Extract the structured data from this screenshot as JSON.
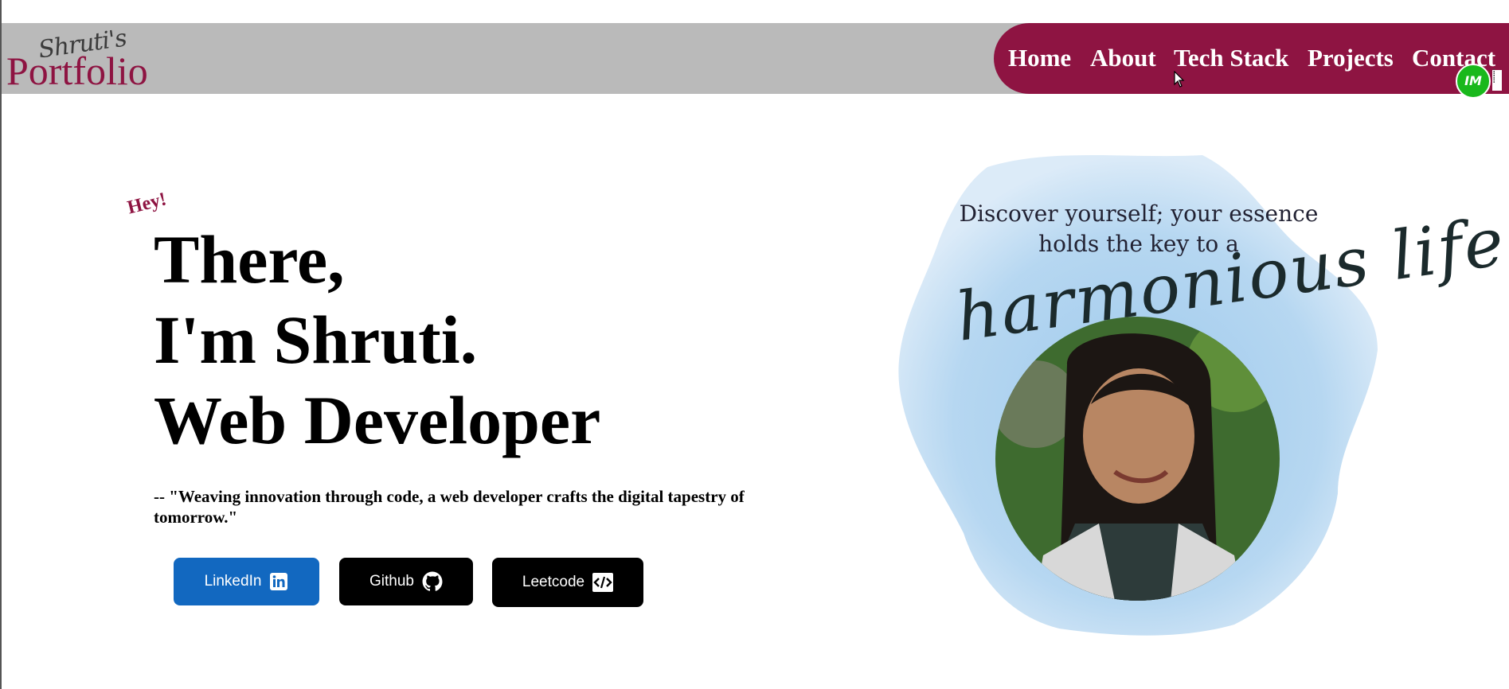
{
  "header": {
    "logo_script": "Shruti's",
    "logo_main": "Portfolio",
    "nav": [
      {
        "label": "Home"
      },
      {
        "label": "About"
      },
      {
        "label": "Tech Stack"
      },
      {
        "label": "Projects"
      },
      {
        "label": "Contact"
      }
    ],
    "extension_badge": "IM",
    "colors": {
      "nav_bg": "#8e1442",
      "header_bg": "#bababa"
    }
  },
  "hero": {
    "greeting": "Hey!",
    "lines": [
      "There,",
      "I'm Shruti.",
      "Web Developer"
    ],
    "quote": "-- \"Weaving innovation through code, a web developer crafts the digital tapestry of tomorrow.\"",
    "buttons": [
      {
        "label": "LinkedIn",
        "icon": "linkedin-icon",
        "color": "#1268c0"
      },
      {
        "label": "Github",
        "icon": "github-icon",
        "color": "#000000"
      },
      {
        "label": "Leetcode",
        "icon": "code-icon",
        "color": "#000000"
      }
    ]
  },
  "art": {
    "text": "Discover yourself; your essence holds the key to a",
    "script": "harmonious life.",
    "portrait_alt": "portrait-photo"
  }
}
